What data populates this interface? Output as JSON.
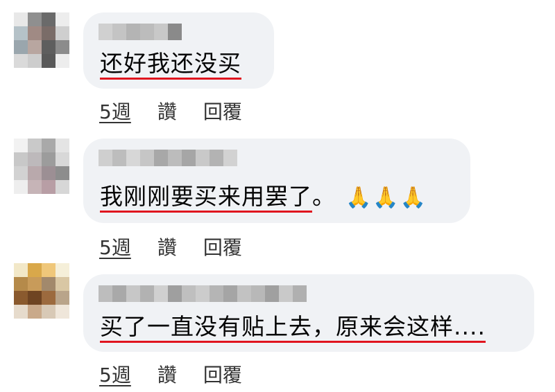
{
  "comments": [
    {
      "text": "还好我还没买",
      "emoji": "",
      "time": "5週",
      "like": "讚",
      "reply": "回覆",
      "avatar_colors": [
        "#e8e8e8",
        "#8f8f8f",
        "#6a6a6a",
        "#ededed",
        "#b5c2c8",
        "#a08a84",
        "#7a6c68",
        "#cfcfcf",
        "#9aa6ad",
        "#b8a6a0",
        "#5e5e5e",
        "#8c8c8c",
        "#dadada",
        "#cdcdcd",
        "#595959",
        "#ededed"
      ],
      "author_colors": [
        "#d0d0d0",
        "#c4c4c4",
        "#b4b4b4",
        "#bcbcbc",
        "#c8c8c8",
        "#8a8a8a"
      ]
    },
    {
      "text": "我刚刚要买来用罢了",
      "emoji": "🙏🙏🙏",
      "time": "5週",
      "like": "讚",
      "reply": "回覆",
      "avatar_colors": [
        "#f2f2f2",
        "#c9c9c9",
        "#a9a9a9",
        "#e4e4e4",
        "#c8c8c8",
        "#bdb9bb",
        "#9c9c9c",
        "#d8d8d8",
        "#d2d2d2",
        "#b9a9ac",
        "#9c8f94",
        "#8d8d8d",
        "#eeeeee",
        "#c6b4b7",
        "#b89ea5",
        "#d7d7d7"
      ],
      "author_colors": [
        "#cfcfcf",
        "#bdbdbd",
        "#d7d7d7",
        "#c6c6c6",
        "#a8a8a8",
        "#bcbcbc",
        "#a6a6a6",
        "#c9c9c9",
        "#b3b3b3",
        "#d2d2d2"
      ]
    },
    {
      "text": "买了一直没有贴上去，原来会这样....",
      "emoji": "",
      "time": "5週",
      "like": "讚",
      "reply": "回覆",
      "avatar_colors": [
        "#f2e8c8",
        "#d9a84a",
        "#efc77a",
        "#f5efd9",
        "#b58a4a",
        "#c89b5a",
        "#a2896c",
        "#d9c7a4",
        "#8a5a2e",
        "#6e4422",
        "#9c6a3e",
        "#b9a48a",
        "#e6dbcc",
        "#c9a98a",
        "#d8c9b6",
        "#efe6da"
      ],
      "author_colors": [
        "#bdbdbd",
        "#a9a9a9",
        "#c7c7c7",
        "#b2b2b2",
        "#d0d0d0",
        "#9f9f9f",
        "#bfbfbf",
        "#cccccc",
        "#b5b5b5",
        "#a5a5a5",
        "#c2c2c2",
        "#b8b8b8",
        "#a0a0a0",
        "#c9c9c9",
        "#b0b0b0"
      ]
    }
  ]
}
